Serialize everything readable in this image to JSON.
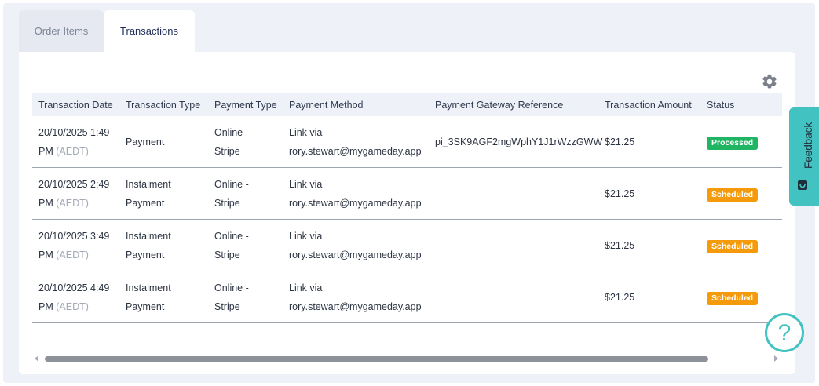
{
  "tabs": [
    {
      "label": "Order Items",
      "active": false
    },
    {
      "label": "Transactions",
      "active": true
    }
  ],
  "table": {
    "headers": [
      "Transaction Date",
      "Transaction Type",
      "Payment Type",
      "Payment Method",
      "Payment Gateway Reference",
      "Transaction Amount",
      "Status"
    ],
    "rows": [
      {
        "date_line1": "20/10/2025 1:49",
        "date_line2": "PM",
        "tz": "(AEDT)",
        "type_line1": "Payment",
        "type_line2": "",
        "payment_type_line1": "Online -",
        "payment_type_line2": "Stripe",
        "method_line1": "Link via",
        "method_line2": "rory.stewart@mygameday.app",
        "reference": "pi_3SK9AGF2mgWphY1J1rWzzGWW",
        "amount": "$21.25",
        "status": "Processed"
      },
      {
        "date_line1": "20/10/2025 2:49",
        "date_line2": "PM",
        "tz": "(AEDT)",
        "type_line1": "Instalment",
        "type_line2": "Payment",
        "payment_type_line1": "Online -",
        "payment_type_line2": "Stripe",
        "method_line1": "Link via",
        "method_line2": "rory.stewart@mygameday.app",
        "reference": "",
        "amount": "$21.25",
        "status": "Scheduled"
      },
      {
        "date_line1": "20/10/2025 3:49",
        "date_line2": "PM",
        "tz": "(AEDT)",
        "type_line1": "Instalment",
        "type_line2": "Payment",
        "payment_type_line1": "Online -",
        "payment_type_line2": "Stripe",
        "method_line1": "Link via",
        "method_line2": "rory.stewart@mygameday.app",
        "reference": "",
        "amount": "$21.25",
        "status": "Scheduled"
      },
      {
        "date_line1": "20/10/2025 4:49",
        "date_line2": "PM",
        "tz": "(AEDT)",
        "type_line1": "Instalment",
        "type_line2": "Payment",
        "payment_type_line1": "Online -",
        "payment_type_line2": "Stripe",
        "method_line1": "Link via",
        "method_line2": "rory.stewart@mygameday.app",
        "reference": "",
        "amount": "$21.25",
        "status": "Scheduled"
      }
    ]
  },
  "feedback": {
    "label": "Feedback",
    "icon": "feedback-smile-icon"
  },
  "help": {
    "label": "?",
    "icon": "help-icon"
  },
  "toolbar": {
    "settings_icon": "gear-icon"
  },
  "colors": {
    "accent_teal": "#42c2c0",
    "processed": "#20b562",
    "scheduled": "#f59a0a",
    "tab_active_text": "#1f2e5a"
  }
}
